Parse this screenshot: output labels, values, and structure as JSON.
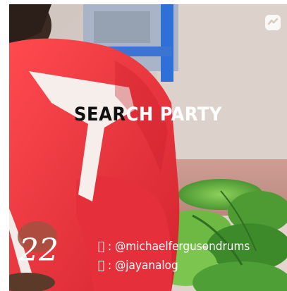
{
  "title": {
    "dark_part": "SEAR",
    "light_part": "CH PARTY"
  },
  "episode_number": "22",
  "credits": [
    {
      "icon": "instagram-icon",
      "glyph": "",
      "text": ": @michaelfergusondrums"
    },
    {
      "icon": "instagram-icon",
      "glyph": "",
      "text": ": @jayanalog"
    }
  ],
  "badge_icon": "app-logo-icon",
  "colors": {
    "jacket_red": "#e8343d",
    "stripe_white": "#f6f1ee",
    "leaf_green": "#5fa640",
    "window_blue": "#2d6ed6",
    "wall_beige": "#d9c9bd"
  }
}
